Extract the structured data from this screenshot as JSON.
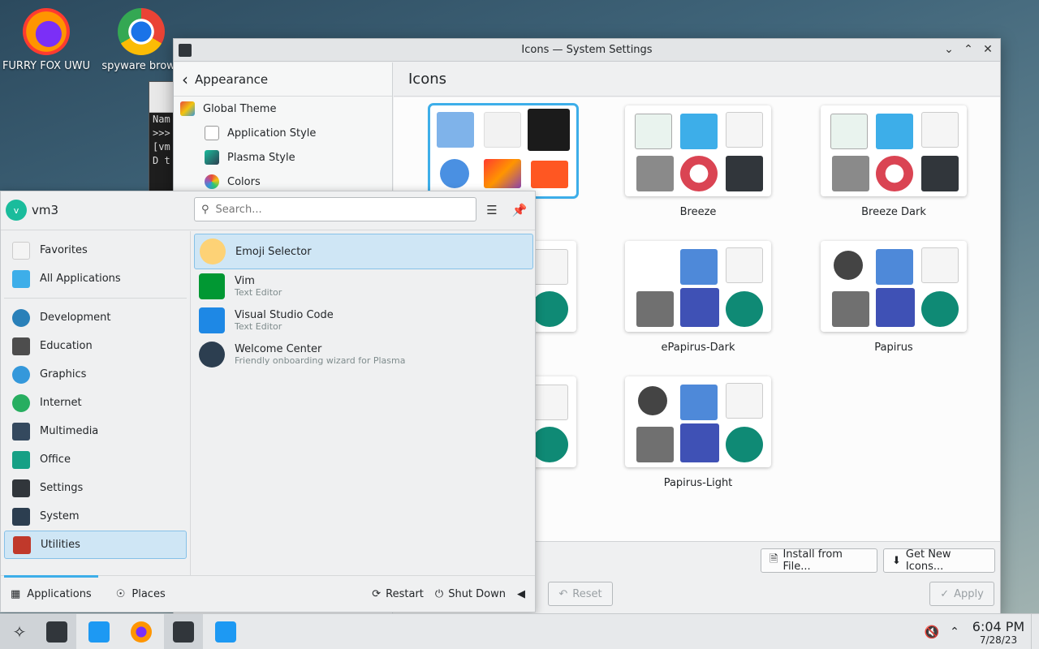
{
  "desktop": {
    "icons": [
      {
        "label": "FURRY FOX UWU"
      },
      {
        "label": "spyware brows"
      }
    ]
  },
  "terminal": {
    "lines": [
      "Nam",
      ">>>",
      "[vm",
      "D t"
    ]
  },
  "settings": {
    "window_title": "Icons — System Settings",
    "sidebar": {
      "back_label": "Appearance",
      "items": [
        {
          "label": "Global Theme"
        },
        {
          "label": "Application Style"
        },
        {
          "label": "Plasma Style"
        },
        {
          "label": "Colors"
        }
      ]
    },
    "page_title": "Icons",
    "themes": [
      {
        "name": ""
      },
      {
        "name": "Breeze"
      },
      {
        "name": "Breeze Dark"
      },
      {
        "name": ""
      },
      {
        "name": "ePapirus-Dark"
      },
      {
        "name": "Papirus"
      },
      {
        "name": ""
      },
      {
        "name": "Papirus-Light"
      }
    ],
    "buttons": {
      "install_from_file": "Install from File...",
      "get_new_icons": "Get New Icons...",
      "reset": "Reset",
      "apply": "Apply"
    }
  },
  "launcher": {
    "avatar_letter": "v",
    "username": "vm3",
    "search_placeholder": "Search...",
    "categories": [
      {
        "label": "Favorites",
        "color": "#f4f4f4"
      },
      {
        "label": "All Applications",
        "color": "#3daee9"
      },
      {
        "label": "Development",
        "color": "#2980b9"
      },
      {
        "label": "Education",
        "color": "#4d4d4d"
      },
      {
        "label": "Graphics",
        "color": "#3498db"
      },
      {
        "label": "Internet",
        "color": "#27ae60"
      },
      {
        "label": "Multimedia",
        "color": "#34495e"
      },
      {
        "label": "Office",
        "color": "#16a085"
      },
      {
        "label": "Settings",
        "color": "#31363b"
      },
      {
        "label": "System",
        "color": "#2c3e50"
      },
      {
        "label": "Utilities",
        "color": "#c0392b"
      }
    ],
    "apps": [
      {
        "name": "Emoji Selector",
        "desc": ""
      },
      {
        "name": "Vim",
        "desc": "Text Editor"
      },
      {
        "name": "Visual Studio Code",
        "desc": "Text Editor"
      },
      {
        "name": "Welcome Center",
        "desc": "Friendly onboarding wizard for Plasma"
      }
    ],
    "bottom": {
      "applications": "Applications",
      "places": "Places",
      "restart": "Restart",
      "shut_down": "Shut Down"
    }
  },
  "taskbar": {
    "time": "6:04 PM",
    "date": "7/28/23"
  }
}
